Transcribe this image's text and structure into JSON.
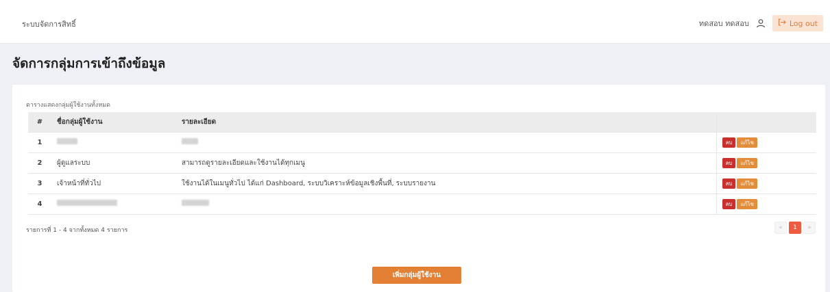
{
  "header": {
    "brand": "ระบบจัดการสิทธิ์",
    "user_name": "ทดสอบ ทดสอบ",
    "logout_label": "Log out"
  },
  "page": {
    "title": "จัดการกลุ่มการเข้าถึงข้อมูล"
  },
  "table": {
    "caption": "ตารางแสดงกลุ่มผู้ใช้งานทั้งหมด",
    "columns": [
      "#",
      "ชื่อกลุ่มผู้ใช้งาน",
      "รายละเอียด",
      ""
    ],
    "rows": [
      {
        "num": "1",
        "name": "",
        "desc": "",
        "name_redacted": true,
        "desc_redacted": true
      },
      {
        "num": "2",
        "name": "ผู้ดูแลระบบ",
        "desc": "สามารถดูรายละเอียดและใช้งานได้ทุกเมนู"
      },
      {
        "num": "3",
        "name": "เจ้าหน้าที่ทั่วไป",
        "desc": "ใช้งานได้ในเมนูทั่วไป ได้แก่ Dashboard, ระบบวิเคราะห์ข้อมูลเชิงพื้นที่, ระบบรายงาน"
      },
      {
        "num": "4",
        "name": "",
        "desc": "",
        "name_redacted": true,
        "desc_redacted": true
      }
    ],
    "delete_label": "ลบ",
    "edit_label": "แก้ไข"
  },
  "footer": {
    "summary": "รายการที่ 1 - 4 จากทั้งหมด 4 รายการ",
    "pagination": {
      "prev": "«",
      "current": "1",
      "next": "»"
    }
  },
  "actions": {
    "add_group_label": "เพิ่มกลุ่มผู้ใช้งาน"
  },
  "colors": {
    "accent": "#e38035",
    "delete": "#c9302c",
    "page_active": "#ef5b3f"
  },
  "icons": {
    "user": "user-icon",
    "logout": "logout-icon"
  }
}
